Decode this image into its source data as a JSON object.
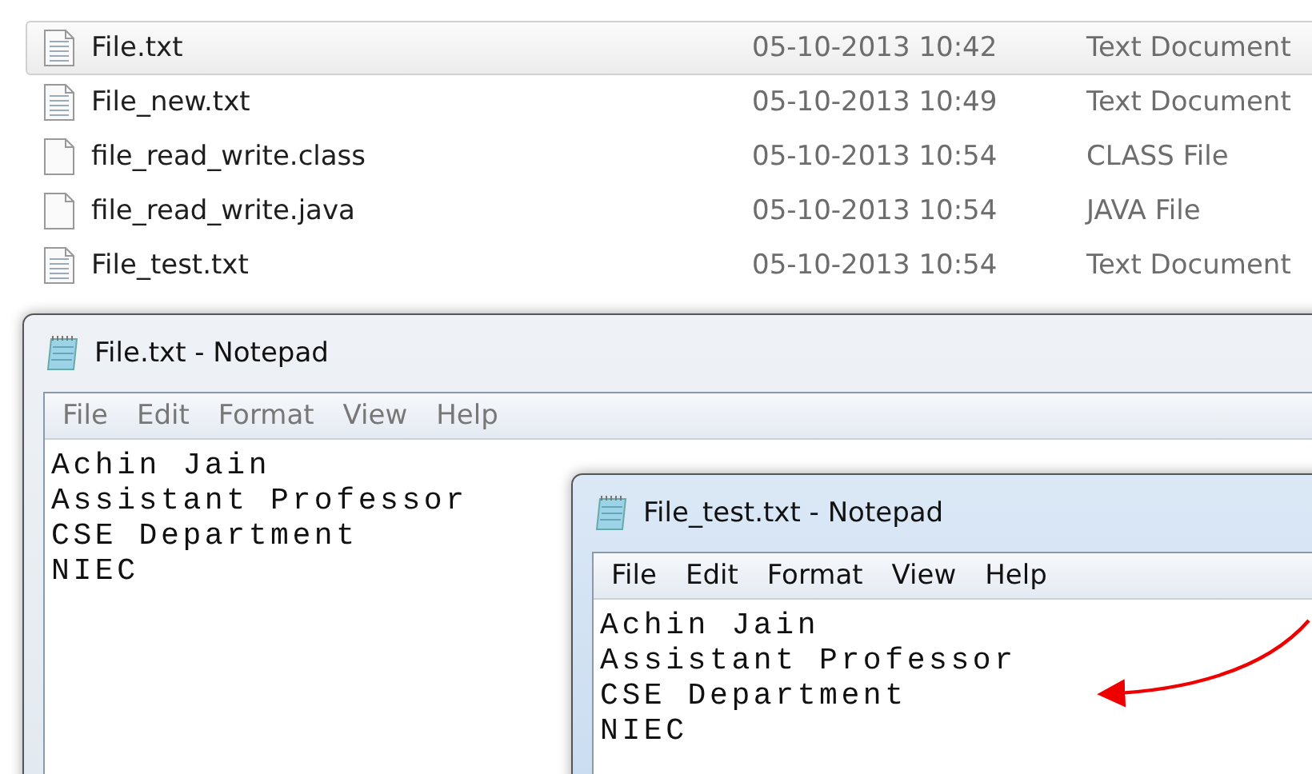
{
  "file_list": {
    "rows": [
      {
        "name": "File.txt",
        "date_modified": "05-10-2013 10:42",
        "type": "Text Document",
        "kind": "text",
        "selected": true
      },
      {
        "name": "File_new.txt",
        "date_modified": "05-10-2013 10:49",
        "type": "Text Document",
        "kind": "text",
        "selected": false
      },
      {
        "name": "file_read_write.class",
        "date_modified": "05-10-2013 10:54",
        "type": "CLASS File",
        "kind": "blank",
        "selected": false
      },
      {
        "name": "file_read_write.java",
        "date_modified": "05-10-2013 10:54",
        "type": "JAVA File",
        "kind": "blank",
        "selected": false
      },
      {
        "name": "File_test.txt",
        "date_modified": "05-10-2013 10:54",
        "type": "Text Document",
        "kind": "text",
        "selected": false
      }
    ]
  },
  "windows": [
    {
      "title": "File.txt - Notepad",
      "active": false,
      "menu": [
        "File",
        "Edit",
        "Format",
        "View",
        "Help"
      ],
      "lines": [
        "Achin Jain",
        "Assistant Professor",
        "CSE Department",
        "NIEC"
      ]
    },
    {
      "title": "File_test.txt - Notepad",
      "active": true,
      "menu": [
        "File",
        "Edit",
        "Format",
        "View",
        "Help"
      ],
      "lines": [
        "Achin Jain",
        "Assistant Professor",
        "CSE Department",
        "NIEC"
      ]
    }
  ]
}
